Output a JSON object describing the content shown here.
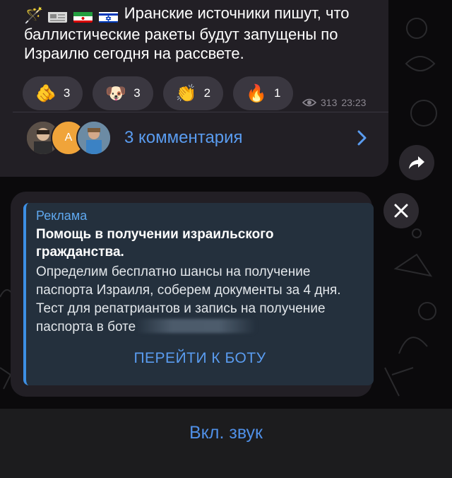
{
  "message": {
    "emoji_prefix": "🪄",
    "text": "Иранские источники пишут, что баллистические ракеты будут запущены по Израилю сегодня на рассвете.",
    "reactions": [
      {
        "emoji": "🫵",
        "count": "3"
      },
      {
        "emoji": "🐶",
        "count": "3"
      },
      {
        "emoji": "👏",
        "count": "2"
      },
      {
        "emoji": "🔥",
        "count": "1"
      }
    ],
    "views": "313",
    "time": "23:23",
    "comments_label": "3 комментария",
    "avatar_initial": "A"
  },
  "ad": {
    "tag": "Реклама",
    "title": "Помощь в получении израильского гражданства.",
    "body": "Определим бесплатно шансы на получение паспорта Израиля, соберем документы за 4 дня. Тест для репатриантов и запись на получение паспорта в боте",
    "button_label": "ПЕРЕЙТИ К БОТУ"
  },
  "bottom": {
    "sound_label": "Вкл. звук"
  },
  "colors": {
    "accent": "#5a9cf0",
    "bubble": "#221f25",
    "ad_background": "#24303d"
  }
}
